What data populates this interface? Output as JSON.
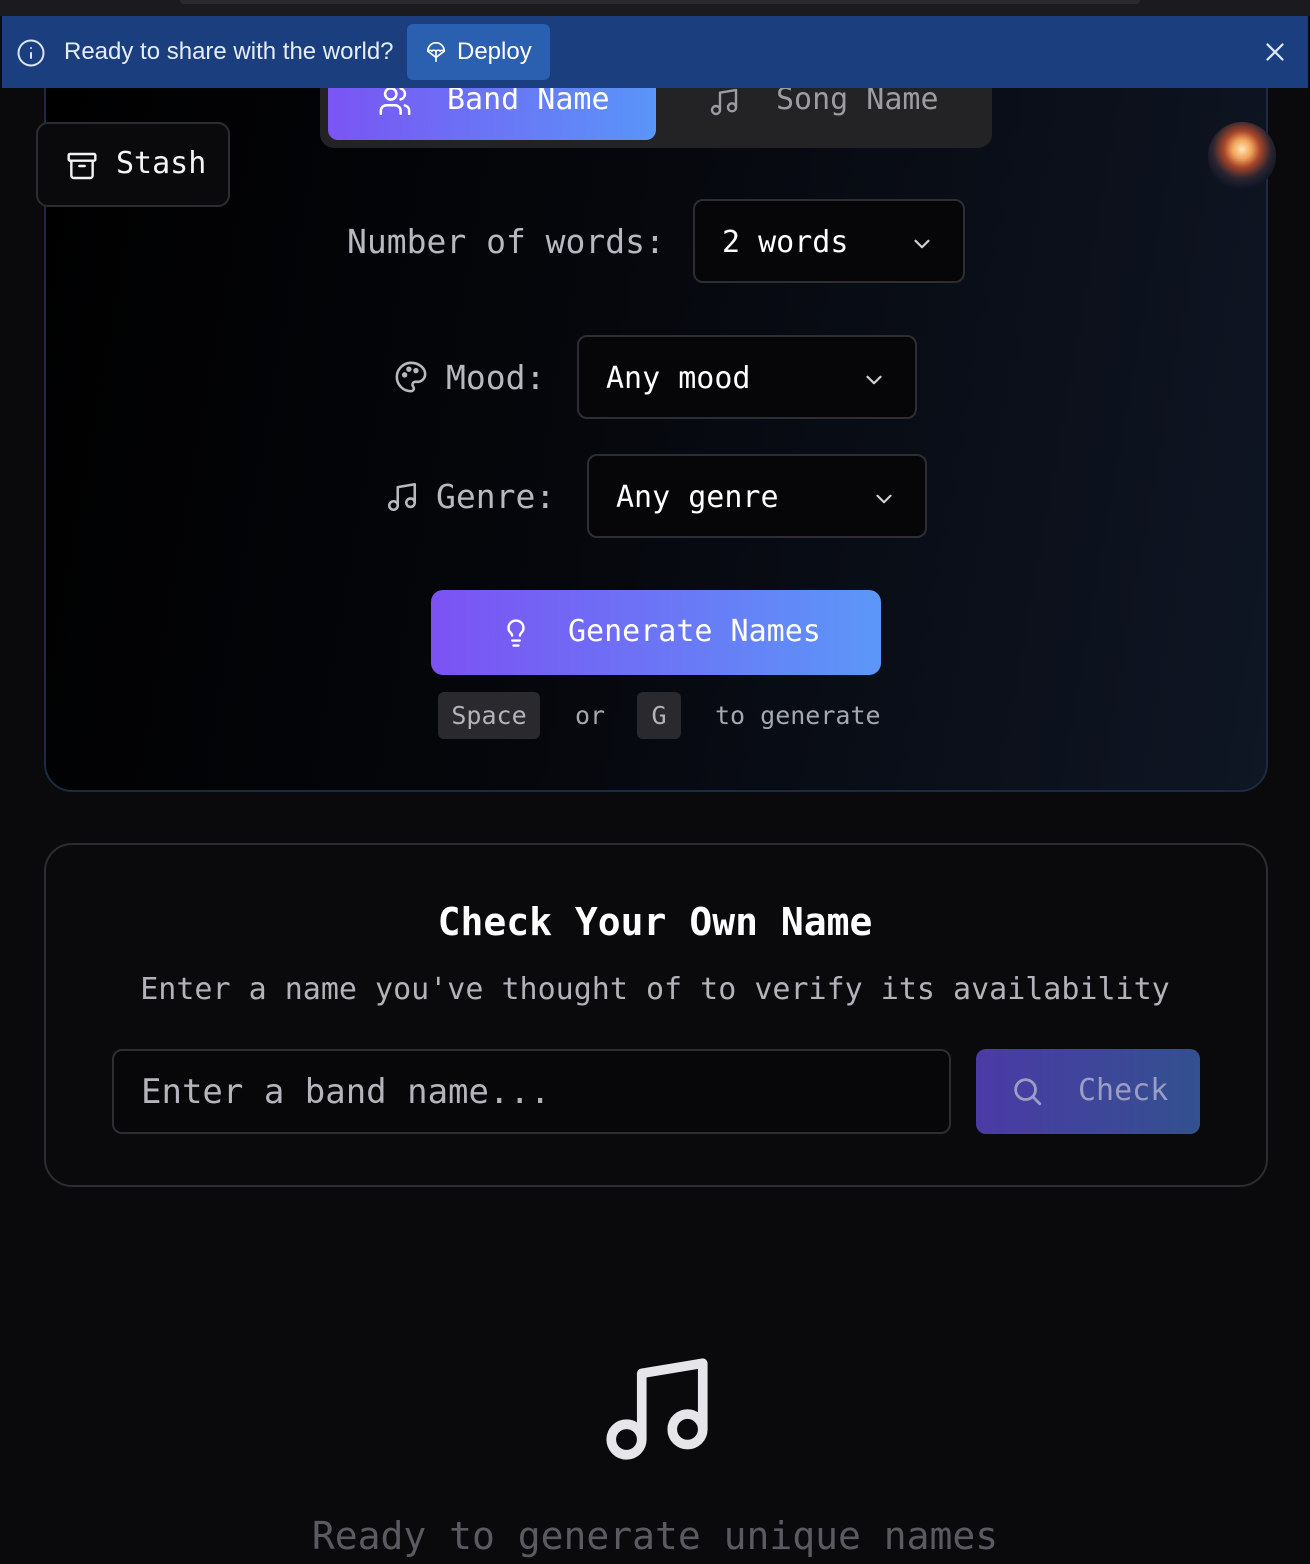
{
  "banner": {
    "message": "Ready to share with the world?",
    "deploy_label": "Deploy"
  },
  "tabs": [
    {
      "label": "Band Name",
      "active": true
    },
    {
      "label": "Song Name",
      "active": false
    }
  ],
  "stash": {
    "label": "Stash"
  },
  "form": {
    "words_label": "Number of words:",
    "words_value": "2 words",
    "mood_label": "Mood:",
    "mood_value": "Any mood",
    "genre_label": "Genre:",
    "genre_value": "Any genre",
    "generate_label": "Generate Names",
    "hint": {
      "key1": "Space",
      "or": "or",
      "key2": "G",
      "suffix": "to generate"
    }
  },
  "check": {
    "title": "Check Your Own Name",
    "subtitle": "Enter a name you've thought of to verify its availability",
    "placeholder": "Enter a band name...",
    "button_label": "Check"
  },
  "empty_state": {
    "text": "Ready to generate unique names"
  },
  "colors": {
    "banner": "#1b3f7e",
    "accent_start": "#7a55f4",
    "accent_end": "#5a95f8",
    "background": "#0a0a0c"
  }
}
